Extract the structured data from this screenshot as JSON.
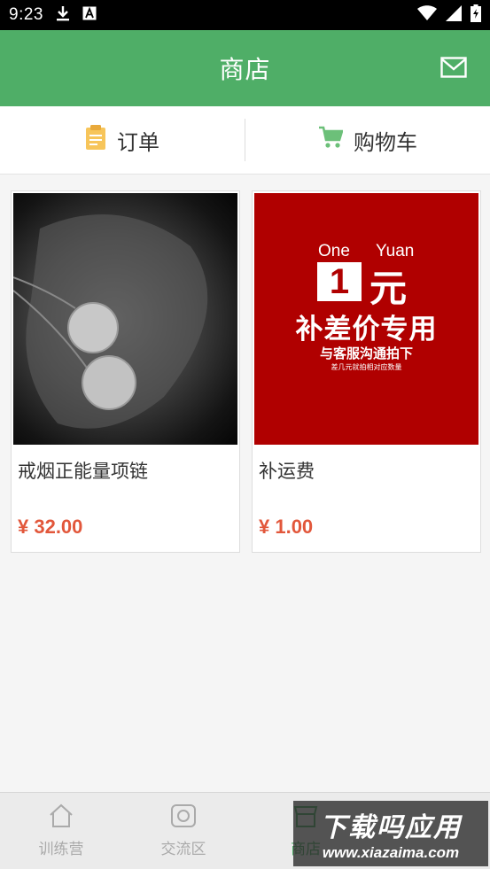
{
  "status_bar": {
    "time": "9:23",
    "left_icons": [
      "download-icon",
      "a-icon"
    ],
    "right_icons": [
      "wifi-icon",
      "signal-icon",
      "battery-icon"
    ]
  },
  "header": {
    "title": "商店",
    "action_icon": "mail-icon"
  },
  "tabs": [
    {
      "label": "订单",
      "icon": "clipboard-icon"
    },
    {
      "label": "购物车",
      "icon": "cart-icon"
    }
  ],
  "products": [
    {
      "name": "戒烟正能量项链",
      "price": "¥ 32.00"
    },
    {
      "name": "补运费",
      "price": "¥ 1.00",
      "image_text": {
        "one": "One",
        "yuan_en": "Yuan",
        "num": "1",
        "yuan_cn": "元",
        "main": "补差价专用",
        "sub": "与客服沟通拍下",
        "tiny": "差几元就拍相对应数量"
      }
    }
  ],
  "bottom_nav": [
    {
      "label": "训练营",
      "icon": "home-icon",
      "active": false
    },
    {
      "label": "交流区",
      "icon": "camera-icon",
      "active": false
    },
    {
      "label": "商店",
      "icon": "store-icon",
      "active": true
    }
  ],
  "watermark": {
    "title": "下载吗应用",
    "url": "www.xiazaima.com"
  },
  "colors": {
    "primary": "#4fae67",
    "price": "#e2573b",
    "banner_red": "#b00000"
  }
}
